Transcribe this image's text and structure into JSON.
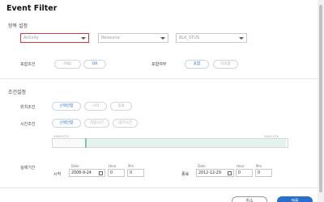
{
  "dialog": {
    "title": "Event Filter"
  },
  "item_settings": {
    "heading": "항목 설정",
    "selects": [
      {
        "placeholder": "Activity"
      },
      {
        "placeholder": "Resource"
      },
      {
        "placeholder": "BLK_STUS"
      }
    ],
    "include_condition": {
      "label": "포함조건",
      "options": [
        "AND",
        "OR"
      ],
      "selected": "OR"
    },
    "include_or_not": {
      "label": "포함여부",
      "options": [
        "포함",
        "미포함"
      ],
      "selected": "포함"
    }
  },
  "condition_settings": {
    "heading": "조건설정",
    "position_condition": {
      "label": "위치조건",
      "options": [
        "선택안함",
        "시작",
        "종료"
      ],
      "selected": "선택안함"
    },
    "time_condition": {
      "label": "시간조건",
      "options": [
        "선택안함",
        "작업시간",
        "대기시간"
      ],
      "selected": "선택안함"
    },
    "timeline": {
      "start_label": "XMNOSTX",
      "end_label": "XMXLSTX"
    }
  },
  "actual_period": {
    "label": "실제기간",
    "captions": {
      "date": "Date",
      "hour": "Hour",
      "min": "Min"
    },
    "start": {
      "label": "시작",
      "date": "2008-9-24",
      "hour": "0",
      "min": "0"
    },
    "end": {
      "label": "종료",
      "date": "2012-12-29",
      "hour": "0",
      "min": "0"
    }
  },
  "footer": {
    "cancel_label": "취소",
    "ok_label": "적용"
  },
  "colors": {
    "accent": "#2a6fc9",
    "active_border": "#d9383a",
    "timeline_fill": "#e4f2f0"
  }
}
